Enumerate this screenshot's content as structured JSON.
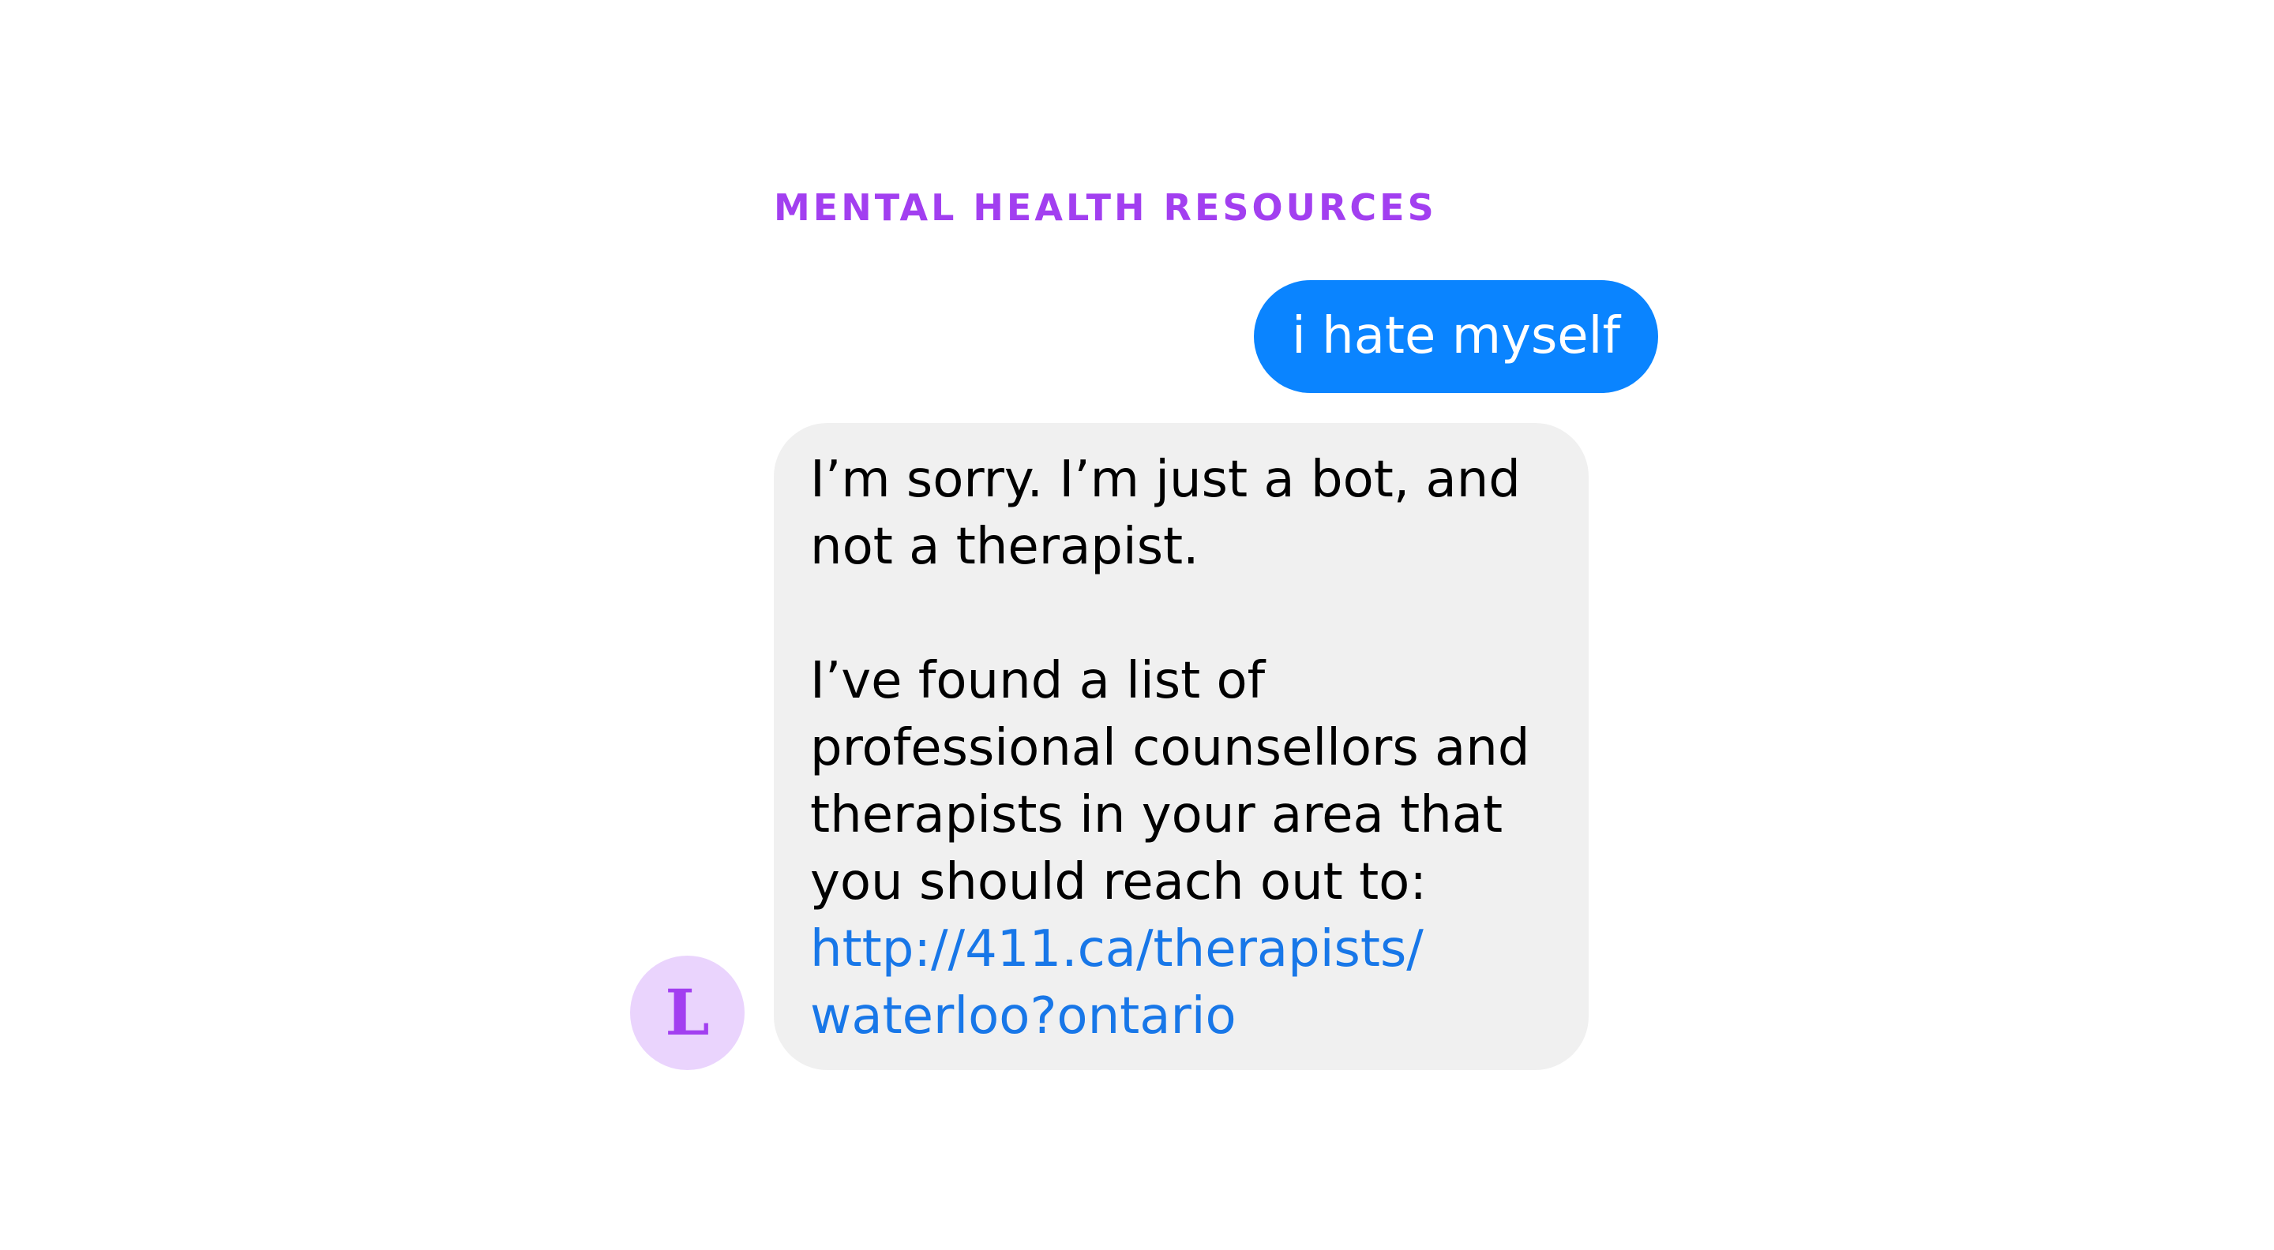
{
  "section": {
    "title": "MENTAL HEALTH RESOURCES"
  },
  "messages": {
    "outgoing": {
      "text": "i hate myself"
    },
    "incoming": {
      "paragraph1": "I’m sorry. I’m just a bot, and not a therapist.",
      "paragraph2": "I’ve found a list of professional counsellors and therapists in your area that you should reach out to:",
      "link_line1": "http://411.ca/therapists/",
      "link_line2": "waterloo?ontario"
    }
  },
  "avatar": {
    "initial": "L"
  },
  "colors": {
    "accent": "#a23ff0",
    "outgoing_bubble": "#0a84ff",
    "incoming_bubble": "#f0f0f0",
    "link": "#1877e8",
    "avatar_bg": "#ead4fd"
  }
}
